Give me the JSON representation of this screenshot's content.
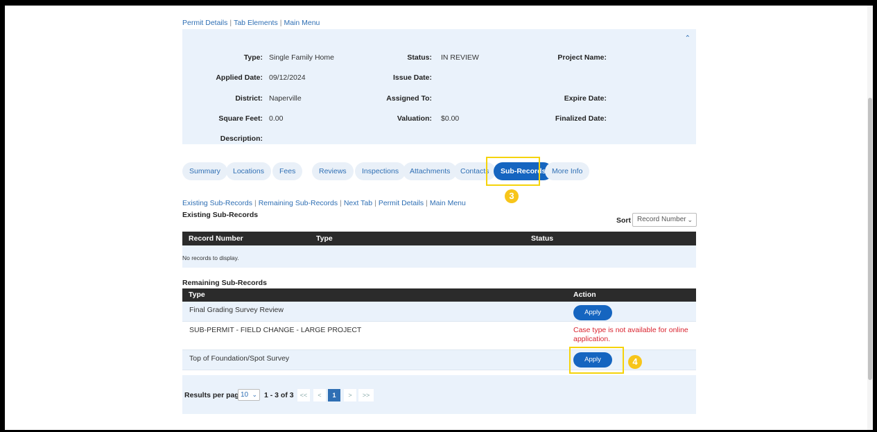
{
  "top_nav": {
    "links": [
      "Permit Details",
      "Tab Elements",
      "Main Menu"
    ]
  },
  "permit": {
    "type_label": "Type:",
    "type": "Single Family Home",
    "status_label": "Status:",
    "status": "IN REVIEW",
    "project_name_label": "Project Name:",
    "applied_date_label": "Applied Date:",
    "applied_date": "09/12/2024",
    "issue_date_label": "Issue Date:",
    "district_label": "District:",
    "district": "Naperville",
    "assigned_to_label": "Assigned To:",
    "expire_date_label": "Expire Date:",
    "square_feet_label": "Square Feet:",
    "square_feet": "0.00",
    "valuation_label": "Valuation:",
    "valuation": "$0.00",
    "finalized_date_label": "Finalized Date:",
    "description_label": "Description:"
  },
  "tabs": [
    "Summary",
    "Locations",
    "Fees",
    "Reviews",
    "Inspections",
    "Attachments",
    "Contacts",
    "Sub-Records",
    "More Info"
  ],
  "active_tab": "Sub-Records",
  "callouts": {
    "tabs": "3",
    "apply": "4"
  },
  "sub_nav": {
    "links": [
      "Existing Sub-Records",
      "Remaining Sub-Records",
      "Next Tab",
      "Permit Details",
      "Main Menu"
    ]
  },
  "existing": {
    "title": "Existing Sub-Records",
    "sort_label": "Sort",
    "sort_value": "Record Number",
    "columns": [
      "Record Number",
      "Type",
      "Status"
    ],
    "empty_text": "No records to display."
  },
  "remaining": {
    "title": "Remaining Sub-Records",
    "columns": [
      "Type",
      "Action"
    ],
    "rows": [
      {
        "type": "Final Grading Survey Review",
        "action": "Apply"
      },
      {
        "type": "SUB-PERMIT - FIELD CHANGE - LARGE PROJECT",
        "action": "Case type is not available for online application."
      },
      {
        "type": "Top of Foundation/Spot Survey",
        "action": "Apply"
      }
    ]
  },
  "pagination": {
    "results_label": "Results per page",
    "per_page": "10",
    "range": "1 - 3 of 3",
    "first": "<<",
    "prev": "<",
    "page": "1",
    "next": ">",
    "last": ">>"
  },
  "colors": {
    "accent": "#1565c0",
    "panel": "#eaf2fb",
    "highlight": "#f5d30a",
    "error": "#d9232e",
    "header": "#2b2b2b"
  }
}
